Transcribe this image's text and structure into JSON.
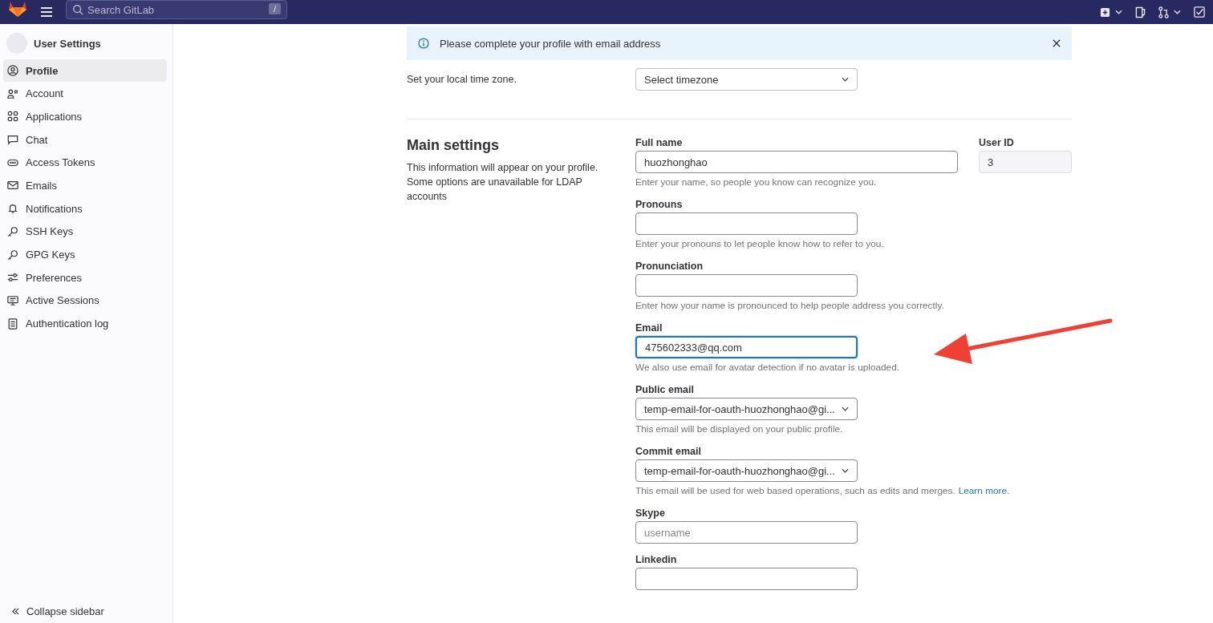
{
  "top_bar": {
    "search": {
      "placeholder": "Search GitLab",
      "shortcut": "/"
    }
  },
  "sidebar": {
    "title": "User Settings",
    "items": [
      {
        "label": "Profile",
        "selected": true
      },
      {
        "label": "Account",
        "selected": false
      },
      {
        "label": "Applications",
        "selected": false
      },
      {
        "label": "Chat",
        "selected": false
      },
      {
        "label": "Access Tokens",
        "selected": false
      },
      {
        "label": "Emails",
        "selected": false
      },
      {
        "label": "Notifications",
        "selected": false
      },
      {
        "label": "SSH Keys",
        "selected": false
      },
      {
        "label": "GPG Keys",
        "selected": false
      },
      {
        "label": "Preferences",
        "selected": false
      },
      {
        "label": "Active Sessions",
        "selected": false
      },
      {
        "label": "Authentication log",
        "selected": false
      }
    ],
    "collapse": "Collapse sidebar"
  },
  "alert": {
    "message": "Please complete your profile with email address"
  },
  "time_settings": {
    "description": "Set your local time zone.",
    "select": "Select timezone"
  },
  "main_settings": {
    "title": "Main settings",
    "description": "This information will appear on your profile. Some options are unavailable for LDAP accounts",
    "full_name": {
      "label": "Full name",
      "value": "huozhonghao",
      "help": "Enter your name, so people you know can recognize you."
    },
    "user_id": {
      "label": "User ID",
      "value": "3"
    },
    "fields": [
      {
        "kind": "text",
        "label": "Pronouns",
        "help": "Enter your pronouns to let people know how to refer to you.",
        "focused": false
      },
      {
        "kind": "text",
        "label": "Pronunciation",
        "help": "Enter how your name is pronounced to help people address you correctly.",
        "focused": false
      },
      {
        "kind": "text",
        "label": "Email",
        "value": "475602333@qq.com",
        "help": "We also use email for avatar detection if no avatar is uploaded.",
        "focused": true
      },
      {
        "kind": "select",
        "label": "Public email",
        "value": "temp-email-for-oauth-huozhonghao@gi...",
        "help": "This email will be displayed on your public profile.",
        "focused": false
      },
      {
        "kind": "select",
        "label": "Commit email",
        "value": "temp-email-for-oauth-huozhonghao@gi...",
        "help": "This email will be used for web based operations, such as edits and merges.",
        "link": "Learn more.",
        "focused": false
      },
      {
        "kind": "text",
        "label": "Skype",
        "placeholder": "username",
        "focused": false
      },
      {
        "kind": "text",
        "label": "Linkedin",
        "focused": false
      }
    ]
  }
}
